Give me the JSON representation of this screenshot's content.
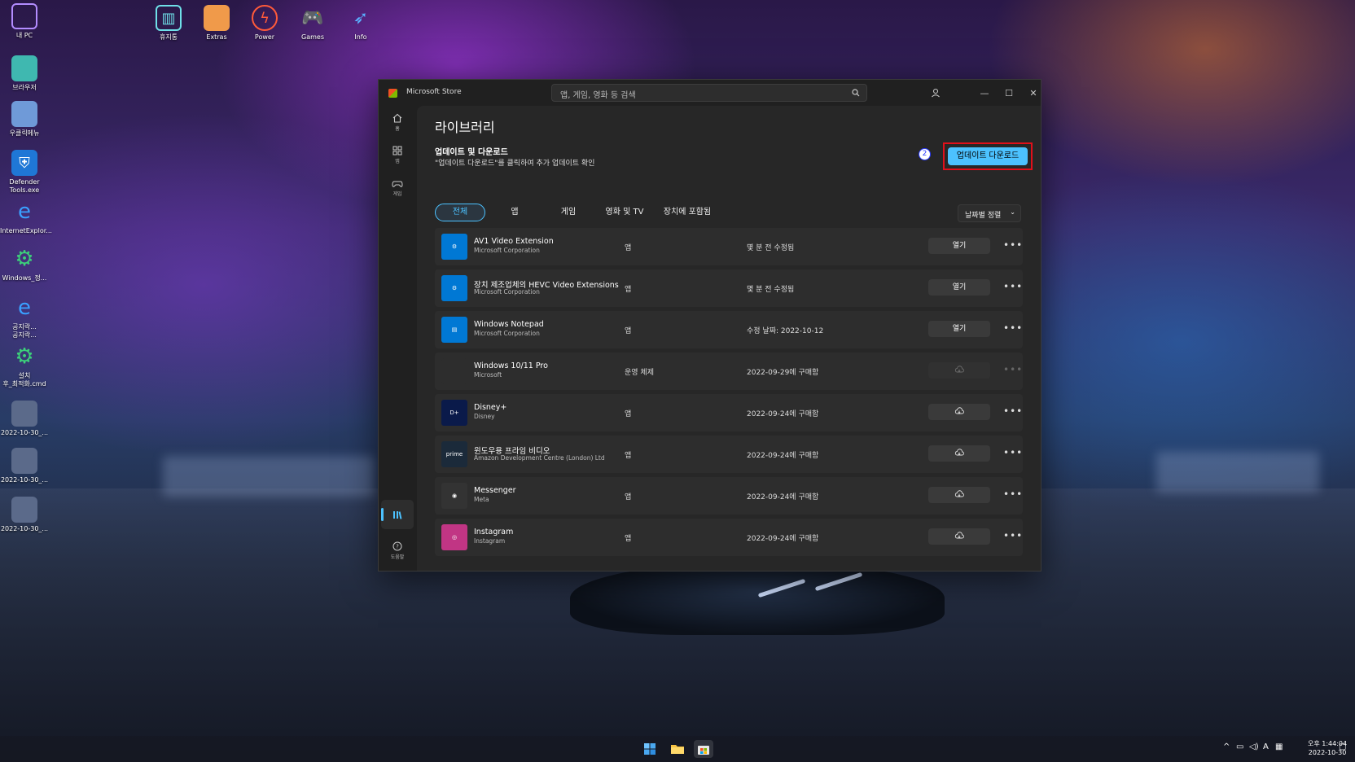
{
  "desktop": {
    "icons": [
      {
        "label": "내 PC",
        "icon": "monitor-icon"
      },
      {
        "label": "브라우저",
        "icon": "browser-icon"
      },
      {
        "label": "우클릭메뉴",
        "icon": "context-menu-icon"
      },
      {
        "label": "Defender\nTools.exe",
        "icon": "shield-icon"
      },
      {
        "label": "InternetExplor...",
        "icon": "ie-icon"
      },
      {
        "label": "Windows_정...",
        "icon": "gear-icon"
      },
      {
        "label": "공지락...\n공지락...",
        "icon": "ie-icon"
      },
      {
        "label": "설치\n후_최적화.cmd",
        "icon": "gear-icon"
      },
      {
        "label": "2022-10-30_...",
        "icon": "image-icon"
      },
      {
        "label": "2022-10-30_...",
        "icon": "image-icon"
      },
      {
        "label": "2022-10-30_...",
        "icon": "image-icon"
      }
    ],
    "top_icons": [
      {
        "label": "휴지통",
        "icon": "trash-icon"
      },
      {
        "label": "Extras",
        "icon": "folder-icon"
      },
      {
        "label": "Power",
        "icon": "power-icon"
      },
      {
        "label": "Games",
        "icon": "gamepad-icon"
      },
      {
        "label": "Info",
        "icon": "bird-icon"
      }
    ]
  },
  "window": {
    "title": "Microsoft Store",
    "search_placeholder": "앱, 게임, 영화 등 검색",
    "nav": [
      {
        "label": "홈",
        "icon": "home-icon"
      },
      {
        "label": "앱",
        "icon": "apps-icon"
      },
      {
        "label": "게임",
        "icon": "gamepad-icon"
      }
    ],
    "nav_bottom": [
      {
        "label": "",
        "icon": "library-icon",
        "active": true
      },
      {
        "label": "도움말",
        "icon": "help-icon"
      }
    ]
  },
  "library": {
    "title": "라이브러리",
    "section_title": "업데이트 및 다운로드",
    "section_desc": "\"업데이트 다운로드\"를 클릭하여 추가 업데이트 확인",
    "step_badge": "2",
    "update_button": "업데이트 다운로드",
    "tabs": [
      "전체",
      "앱",
      "게임",
      "영화 및 TV",
      "장치에 포함됨"
    ],
    "active_tab": 0,
    "sort_label": "날짜별 정렬",
    "items": [
      {
        "name": "AV1 Video Extension",
        "publisher": "Microsoft Corporation",
        "type": "앱",
        "date": "몇 분 전 수정됨",
        "action": "열기",
        "icon_color": "#0078d4",
        "icon": "extension-icon"
      },
      {
        "name": "장치 제조업체의 HEVC Video Extensions",
        "publisher": "Microsoft Corporation",
        "type": "앱",
        "date": "몇 분 전 수정됨",
        "action": "열기",
        "icon_color": "#0078d4",
        "icon": "extension-icon"
      },
      {
        "name": "Windows Notepad",
        "publisher": "Microsoft Corporation",
        "type": "앱",
        "date": "수정 날짜: 2022-10-12",
        "action": "열기",
        "icon_color": "#0078d4",
        "icon": "notepad-icon"
      },
      {
        "name": "Windows 10/11 Pro",
        "publisher": "Microsoft",
        "type": "운영 체제",
        "date": "2022-09-29에 구매함",
        "action": "",
        "icon_color": "#2d2d2d",
        "icon": "windows-icon",
        "disabled": true
      },
      {
        "name": "Disney+",
        "publisher": "Disney",
        "type": "앱",
        "date": "2022-09-24에 구매함",
        "action": "",
        "icon_color": "#0a1a4a",
        "icon": "disney-icon"
      },
      {
        "name": "윈도우용 프라임 비디오",
        "publisher": "Amazon Development Centre (London) Ltd",
        "type": "앱",
        "date": "2022-09-24에 구매함",
        "action": "",
        "icon_color": "#1b2a3a",
        "icon": "prime-video-icon"
      },
      {
        "name": "Messenger",
        "publisher": "Meta",
        "type": "앱",
        "date": "2022-09-24에 구매함",
        "action": "",
        "icon_color": "#333333",
        "icon": "messenger-icon"
      },
      {
        "name": "Instagram",
        "publisher": "Instagram",
        "type": "앱",
        "date": "2022-09-24에 구매함",
        "action": "",
        "icon_color": "#c13584",
        "icon": "instagram-icon"
      }
    ]
  },
  "taskbar": {
    "clock_time": "오후 1:44:04",
    "clock_date": "2022-10-30",
    "ime": "A"
  }
}
